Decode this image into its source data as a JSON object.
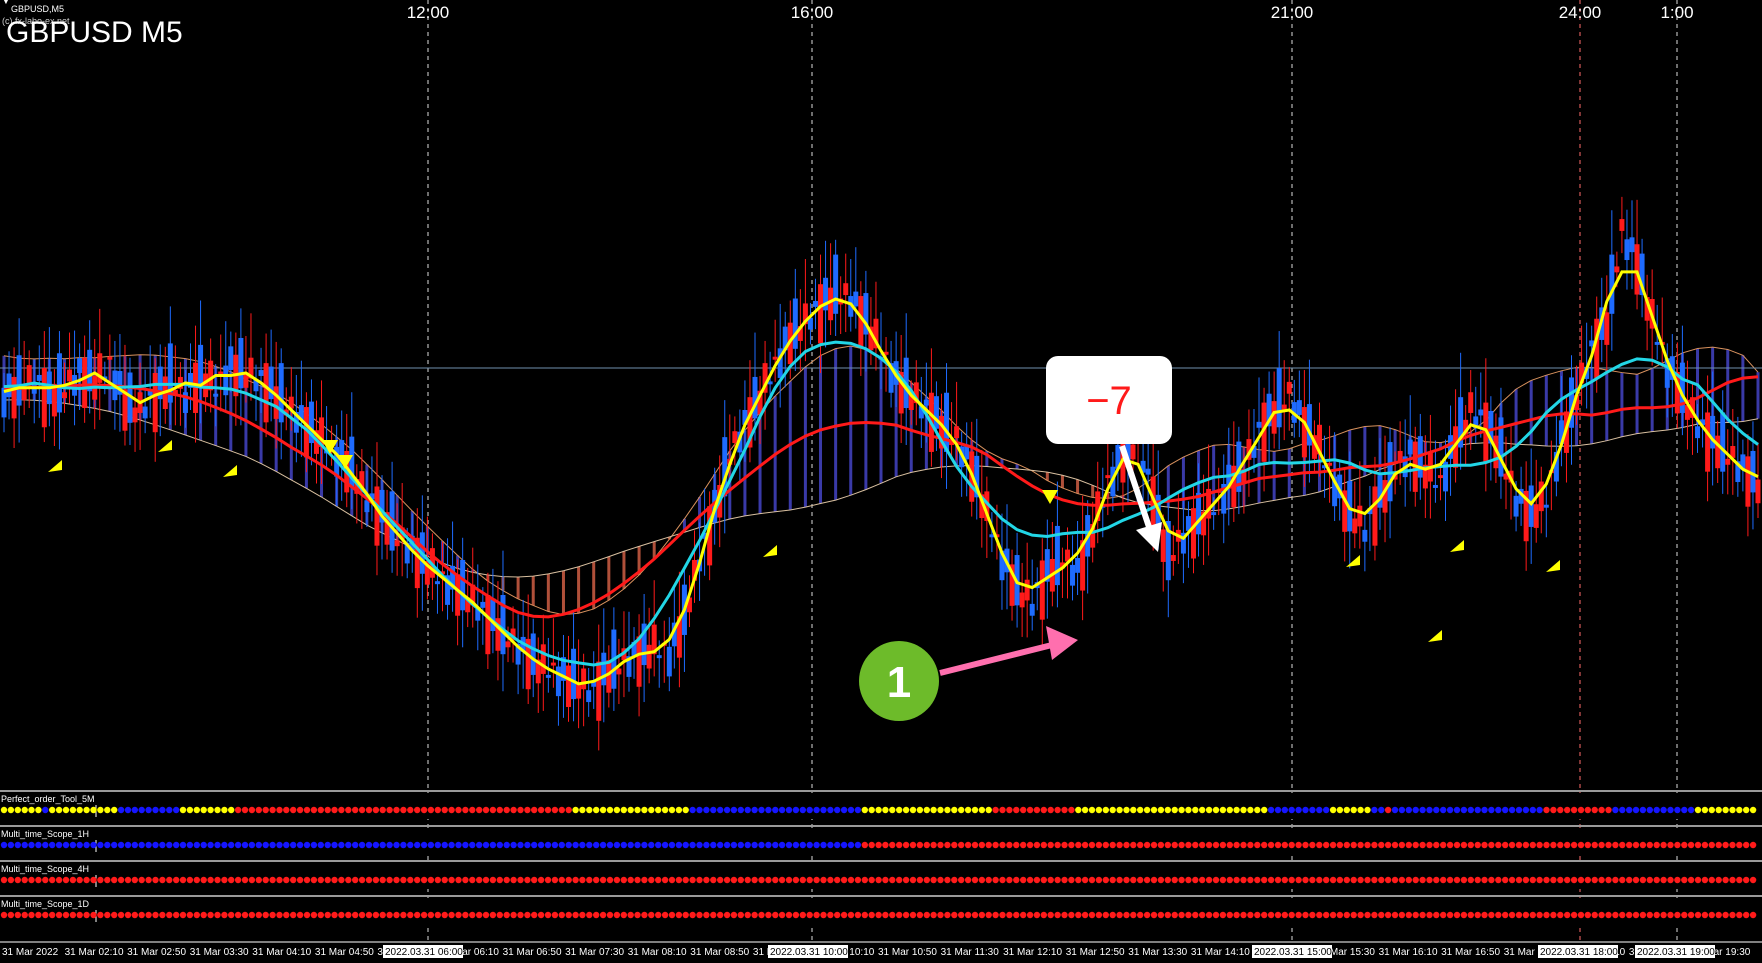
{
  "window": {
    "symbol_tag": "GBPUSD,M5",
    "copyright": "(c) fx-labo-ex.net",
    "title": "GBPUSD M5"
  },
  "top_session_labels": [
    "12:00",
    "16:00",
    "21:00",
    "24:00",
    "1:00"
  ],
  "annotations": {
    "pips_label": "−7",
    "step_marker": "1"
  },
  "colors": {
    "background": "#000000",
    "bull_candle": "#1e6bff",
    "bear_candle": "#ff1a1a",
    "ma_fast": "#ffff00",
    "ma_mid": "#22d6e6",
    "ma_slow": "#ff1a1a",
    "kumo_bull_hatch": "#3a3aa8",
    "kumo_bear_hatch": "#b0503a",
    "signal_arrow": "#ffff00",
    "marker_green": "#6dbb2a",
    "arrow_pink": "#ff6fae"
  },
  "indicators": [
    {
      "name": "Perfect_order_Tool_5M",
      "segments": [
        [
          "yellow",
          6
        ],
        [
          "blue",
          1
        ],
        [
          "yellow",
          10
        ],
        [
          "blue",
          9
        ],
        [
          "yellow",
          8
        ],
        [
          "red",
          49
        ],
        [
          "yellow",
          17
        ],
        [
          "blue",
          25
        ],
        [
          "yellow",
          19
        ],
        [
          "red",
          12
        ],
        [
          "yellow",
          28
        ],
        [
          "blue",
          9
        ],
        [
          "yellow",
          6
        ],
        [
          "blue",
          2
        ],
        [
          "red",
          1
        ],
        [
          "blue",
          22
        ],
        [
          "red",
          10
        ],
        [
          "blue",
          12
        ],
        [
          "yellow",
          9
        ]
      ]
    },
    {
      "name": "Multi_time_Scope_1H",
      "segments": [
        [
          "blue",
          125
        ],
        [
          "red",
          130
        ]
      ]
    },
    {
      "name": "Multi_time_Scope_4H",
      "segments": [
        [
          "red",
          255
        ]
      ]
    },
    {
      "name": "Multi_time_Scope_1D",
      "segments": [
        [
          "red",
          255
        ]
      ]
    }
  ],
  "time_axis": {
    "labels": [
      "31 Mar 2022",
      "31 Mar 02:10",
      "31 Mar 02:50",
      "31 Mar 03:30",
      "31 Mar 04:10",
      "31 Mar 04:50",
      "31 Mar 05:30",
      "31 Mar 06:10",
      "31 Mar 06:50",
      "31 Mar 07:30",
      "31 Mar 08:10",
      "31 Mar 08:50",
      "31 Mar 09:30",
      "31 Mar 10:10",
      "31 Mar 10:50",
      "31 Mar 11:30",
      "31 Mar 12:10",
      "31 Mar 12:50",
      "31 Mar 13:30",
      "31 Mar 14:10",
      "31 Mar 14:50",
      "31 Mar 15:30",
      "31 Mar 16:10",
      "31 Mar 16:50",
      "31 Mar 17:30",
      "31 Mar 18:10",
      "31 Mar 18:50",
      "31 Mar 19:30"
    ],
    "highlights": [
      "2022.03.31 06:00",
      "2022.03.31 10:00",
      "2022.03.31 15:00",
      "2022.03.31 18:00",
      "2022.03.31 19:00"
    ]
  },
  "chart_data": {
    "type": "candlestick",
    "symbol": "GBPUSD",
    "timeframe": "M5",
    "y_range_relative": [
      0,
      100
    ],
    "horizontal_line_level": 68,
    "series": [
      {
        "name": "close_path",
        "values": [
          52,
          53,
          54,
          52,
          53,
          55,
          54,
          56,
          51,
          50,
          52,
          54,
          52,
          55,
          53,
          56,
          55,
          54,
          52,
          50,
          48,
          46,
          44,
          42,
          38,
          36,
          33,
          31,
          29,
          27,
          26,
          24,
          22,
          20,
          18,
          16,
          15,
          14,
          13,
          12,
          15,
          16,
          17,
          18,
          17,
          22,
          30,
          36,
          44,
          48,
          52,
          56,
          60,
          62,
          64,
          66,
          65,
          62,
          58,
          54,
          52,
          50,
          48,
          46,
          42,
          36,
          30,
          26,
          24,
          28,
          30,
          28,
          34,
          40,
          44,
          46,
          38,
          30,
          33,
          35,
          37,
          40,
          42,
          47,
          50,
          52,
          48,
          45,
          40,
          36,
          34,
          38,
          42,
          44,
          42,
          40,
          46,
          50,
          48,
          44,
          38,
          36,
          38,
          46,
          52,
          58,
          62,
          74,
          70,
          62,
          56,
          52,
          48,
          46,
          44,
          42,
          40
        ]
      }
    ]
  }
}
